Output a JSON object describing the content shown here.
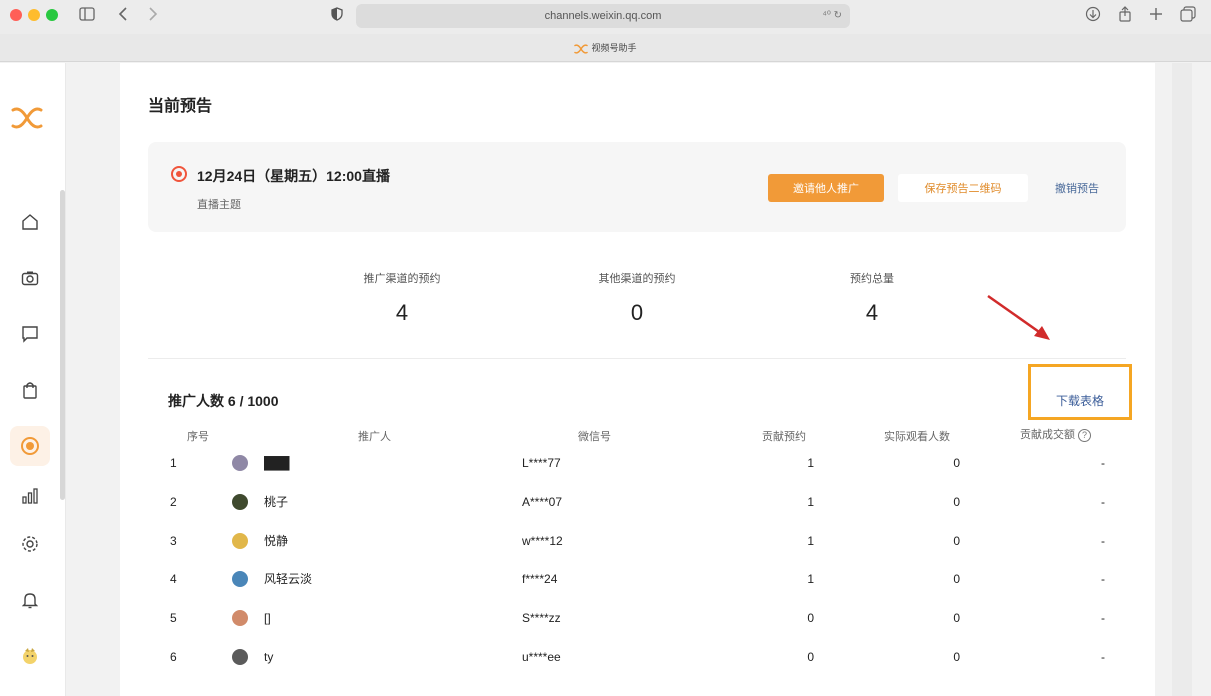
{
  "browser": {
    "url": "channels.weixin.qq.com",
    "url_right": "⁴⁰ ↻",
    "tab_title": "视频号助手",
    "colors": {
      "close": "#ff5f57",
      "minimize": "#febc2e",
      "zoom": "#28c840"
    }
  },
  "sidebar": {
    "active_index": 4,
    "icons": [
      "home-icon",
      "camera-icon",
      "message-icon",
      "bag-icon",
      "live-icon",
      "chart-icon",
      "settings-icon",
      "bell-icon",
      "avatar-icon"
    ]
  },
  "page": {
    "title": "当前预告",
    "live": {
      "title": "12月24日（星期五）12:00直播",
      "subtitle": "直播主题",
      "invite_label": "邀请他人推广",
      "save_label": "保存预告二维码",
      "cancel_label": "撤销预告"
    },
    "stats": [
      {
        "label": "推广渠道的预约",
        "value": "4"
      },
      {
        "label": "其他渠道的预约",
        "value": "0"
      },
      {
        "label": "预约总量",
        "value": "4"
      }
    ],
    "promo_count": "推广人数 6 / 1000",
    "download_label": "下载表格",
    "table": {
      "headers": [
        "序号",
        "推广人",
        "微信号",
        "贡献预约",
        "实际观看人数",
        "贡献成交额"
      ],
      "help_glyph": "?",
      "rows": [
        {
          "index": "1",
          "name": "███",
          "wechat": "L****77",
          "reservations": "1",
          "viewers": "0",
          "sales": "-",
          "avatar_color": "#8f88a6"
        },
        {
          "index": "2",
          "name": "桃子",
          "wechat": "A****07",
          "reservations": "1",
          "viewers": "0",
          "sales": "-",
          "avatar_color": "#3f4a2e"
        },
        {
          "index": "3",
          "name": "悦静",
          "wechat": "w****12",
          "reservations": "1",
          "viewers": "0",
          "sales": "-",
          "avatar_color": "#e1b74a"
        },
        {
          "index": "4",
          "name": "风轻云淡",
          "wechat": "f****24",
          "reservations": "1",
          "viewers": "0",
          "sales": "-",
          "avatar_color": "#4a86b8"
        },
        {
          "index": "5",
          "name": "[]",
          "wechat": "S****zz",
          "reservations": "0",
          "viewers": "0",
          "sales": "-",
          "avatar_color": "#d18b6a"
        },
        {
          "index": "6",
          "name": "ty",
          "wechat": "u****ee",
          "reservations": "0",
          "viewers": "0",
          "sales": "-",
          "avatar_color": "#5b5b5b"
        }
      ]
    }
  },
  "colors": {
    "accent": "#f19a38",
    "highlight_box": "#f5a623",
    "arrow": "#d12b2b",
    "link": "#3b5d99"
  }
}
